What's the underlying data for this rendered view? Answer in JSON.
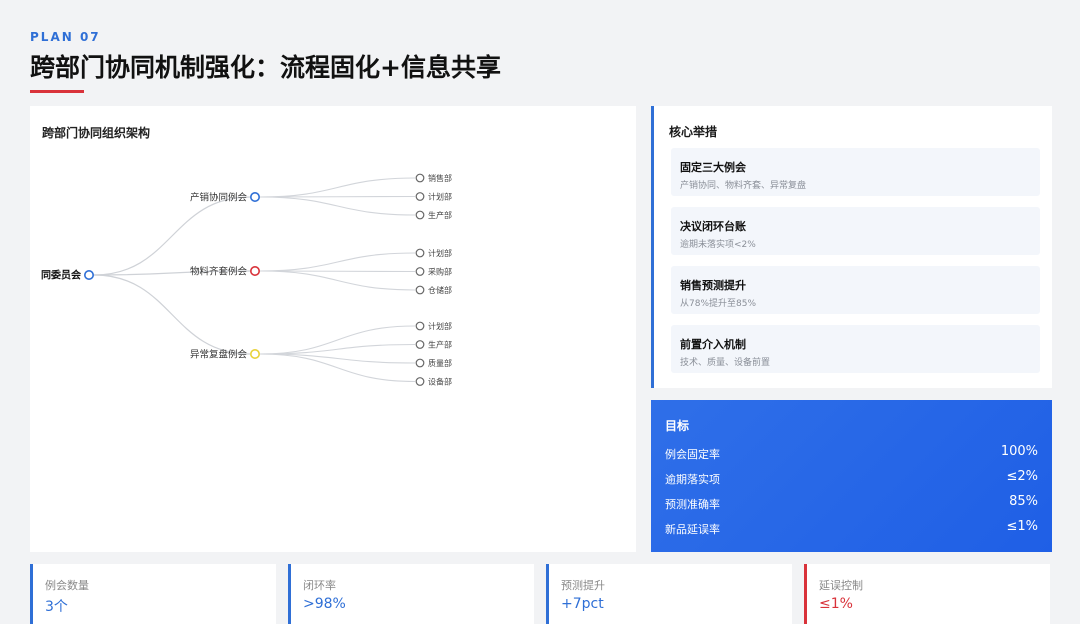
{
  "header": {
    "plan_tag": "PLAN 07",
    "title": "跨部门协同机制强化：流程固化+信息共享"
  },
  "org_chart": {
    "title": "跨部门协同组织架构",
    "root": "同委员会",
    "branches": [
      {
        "label": "产销协同例会",
        "color": "#2f6fd6",
        "leaves": [
          "销售部",
          "计划部",
          "生产部"
        ]
      },
      {
        "label": "物料齐套例会",
        "color": "#d9323a",
        "leaves": [
          "计划部",
          "采购部",
          "仓储部"
        ]
      },
      {
        "label": "异常复盘例会",
        "color": "#e8d23a",
        "leaves": [
          "计划部",
          "生产部",
          "质量部",
          "设备部"
        ]
      }
    ]
  },
  "measures": {
    "title": "核心举措",
    "items": [
      {
        "name": "固定三大例会",
        "desc": "产销协同、物料齐套、异常复盘"
      },
      {
        "name": "决议闭环台账",
        "desc": "逾期未落实项<2%"
      },
      {
        "name": "销售预测提升",
        "desc": "从78%提升至85%"
      },
      {
        "name": "前置介入机制",
        "desc": "技术、质量、设备前置"
      }
    ]
  },
  "targets": {
    "title": "目标",
    "items": [
      {
        "label": "例会固定率",
        "value": "100%"
      },
      {
        "label": "逾期落实项",
        "value": "≤2%"
      },
      {
        "label": "预测准确率",
        "value": "85%"
      },
      {
        "label": "新品延误率",
        "value": "≤1%"
      }
    ]
  },
  "kpis": [
    {
      "label": "例会数量",
      "value": "3个",
      "accent": "blue"
    },
    {
      "label": "闭环率",
      "value": ">98%",
      "accent": "blue"
    },
    {
      "label": "预测提升",
      "value": "+7pct",
      "accent": "blue"
    },
    {
      "label": "延误控制",
      "value": "≤1%",
      "accent": "red"
    }
  ]
}
